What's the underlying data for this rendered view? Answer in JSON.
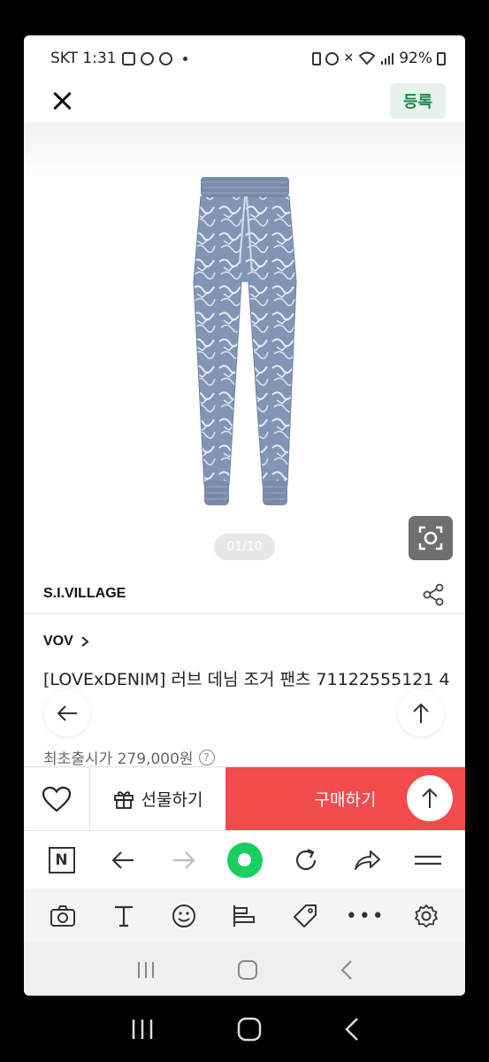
{
  "status_bar": {
    "carrier_time": "SKT 1:31",
    "battery": "92%"
  },
  "topbar": {
    "register_label": "등록"
  },
  "gallery": {
    "counter": "01/10"
  },
  "seller": {
    "name": "S.I.VILLAGE"
  },
  "product": {
    "brand": "VOV",
    "title": "[LOVExDENIM] 러브 데님 조거 팬츠 71122555121 4",
    "price_label": "최초출시가 279,000원"
  },
  "action_bar": {
    "gift_label": "선물하기",
    "buy_label": "구매하기"
  },
  "browser_bar": {
    "n_label": "N"
  },
  "colors": {
    "buy_button": "#f24b4b",
    "register_text": "#1f8a4c",
    "browser_green": "#19ce60"
  }
}
